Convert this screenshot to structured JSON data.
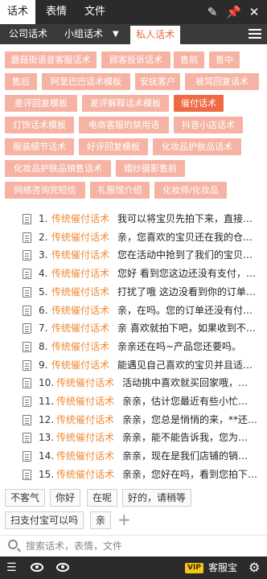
{
  "titlebar": {
    "tabs": [
      {
        "label": "话术"
      },
      {
        "label": "表情"
      },
      {
        "label": "文件"
      }
    ],
    "icons": [
      "edit-icon",
      "pin-icon",
      "close-icon"
    ]
  },
  "subtabs": {
    "items": [
      {
        "label": "公司话术"
      },
      {
        "label": "小组话术"
      },
      {
        "label": "私人话术"
      }
    ],
    "caret": "▼"
  },
  "categories": [
    {
      "label": "蘑菇街语音客服话术"
    },
    {
      "label": "顾客投诉话术"
    },
    {
      "label": "售前"
    },
    {
      "label": "售中"
    },
    {
      "label": "售后"
    },
    {
      "label": "阿里巴巴话术模板"
    },
    {
      "label": "安抚客户"
    },
    {
      "label": "被骂回复话术"
    },
    {
      "label": "差评回复模板"
    },
    {
      "label": "差评解释话术模板"
    },
    {
      "label": "催付话术"
    },
    {
      "label": "灯饰话术模板"
    },
    {
      "label": "电商客服的禁用语"
    },
    {
      "label": "抖音小店话术"
    },
    {
      "label": "服装细节话术"
    },
    {
      "label": "好评回复模板"
    },
    {
      "label": "化妆品护肤品话术"
    },
    {
      "label": "化妆品护肤品销售话术"
    },
    {
      "label": "婚纱摄影售前"
    },
    {
      "label": "网络咨询完短信"
    },
    {
      "label": "礼服馆介绍"
    },
    {
      "label": "化妆师/化妆品"
    }
  ],
  "list": {
    "rows": [
      {
        "num": "1.",
        "category": "传统催付话术",
        "text": "我可以将宝贝先拍下来，直接…"
      },
      {
        "num": "2.",
        "category": "传统催付话术",
        "text": "亲，您喜欢的宝贝还在我的仓…"
      },
      {
        "num": "3.",
        "category": "传统催付话术",
        "text": "您在活动中抢到了我们的宝贝…"
      },
      {
        "num": "4.",
        "category": "传统催付话术",
        "text": "您好 看到您这边还没有支付，…"
      },
      {
        "num": "5.",
        "category": "传统催付话术",
        "text": "打扰了哦 这边没看到你的订单…"
      },
      {
        "num": "6.",
        "category": "传统催付话术",
        "text": "亲，在吗。您的订单还没有付…"
      },
      {
        "num": "7.",
        "category": "传统催付话术",
        "text": "亲 喜欢就拍下吧，如果收到不…"
      },
      {
        "num": "8.",
        "category": "传统催付话术",
        "text": "亲亲还在吗~产品您还要吗。"
      },
      {
        "num": "9.",
        "category": "传统催付话术",
        "text": "能遇见自己喜欢的宝贝并且适…"
      },
      {
        "num": "10.",
        "category": "传统催付话术",
        "text": "活动挑中喜欢就买回家哦，…"
      },
      {
        "num": "11.",
        "category": "传统催付话术",
        "text": "亲亲，估计您最近有些小忙…"
      },
      {
        "num": "12.",
        "category": "传统催付话术",
        "text": "亲亲，您总是悄悄的来，**还…"
      },
      {
        "num": "13.",
        "category": "传统催付话术",
        "text": "亲亲，能不能告诉我，您为…"
      },
      {
        "num": "14.",
        "category": "传统催付话术",
        "text": "亲亲，现在是我们店铺的销…"
      },
      {
        "num": "15.",
        "category": "传统催付话术",
        "text": "亲亲，您好在吗，看到您拍下…"
      }
    ]
  },
  "quick_phrases": [
    {
      "label": "不客气"
    },
    {
      "label": "你好"
    },
    {
      "label": "在呢"
    },
    {
      "label": "好的，请稍等"
    },
    {
      "label": "扫支付宝可以吗"
    },
    {
      "label": "亲"
    }
  ],
  "quick_add": "+",
  "search": {
    "placeholder": "搜索话术，表情，文件"
  },
  "bottombar": {
    "vip_label": "VIP",
    "brand_label": "客服宝"
  },
  "colors": {
    "accent": "#ef6a43",
    "chip": "#f6b3a3",
    "category_text": "#f08a34",
    "dark_bar": "#2b2b2b"
  }
}
